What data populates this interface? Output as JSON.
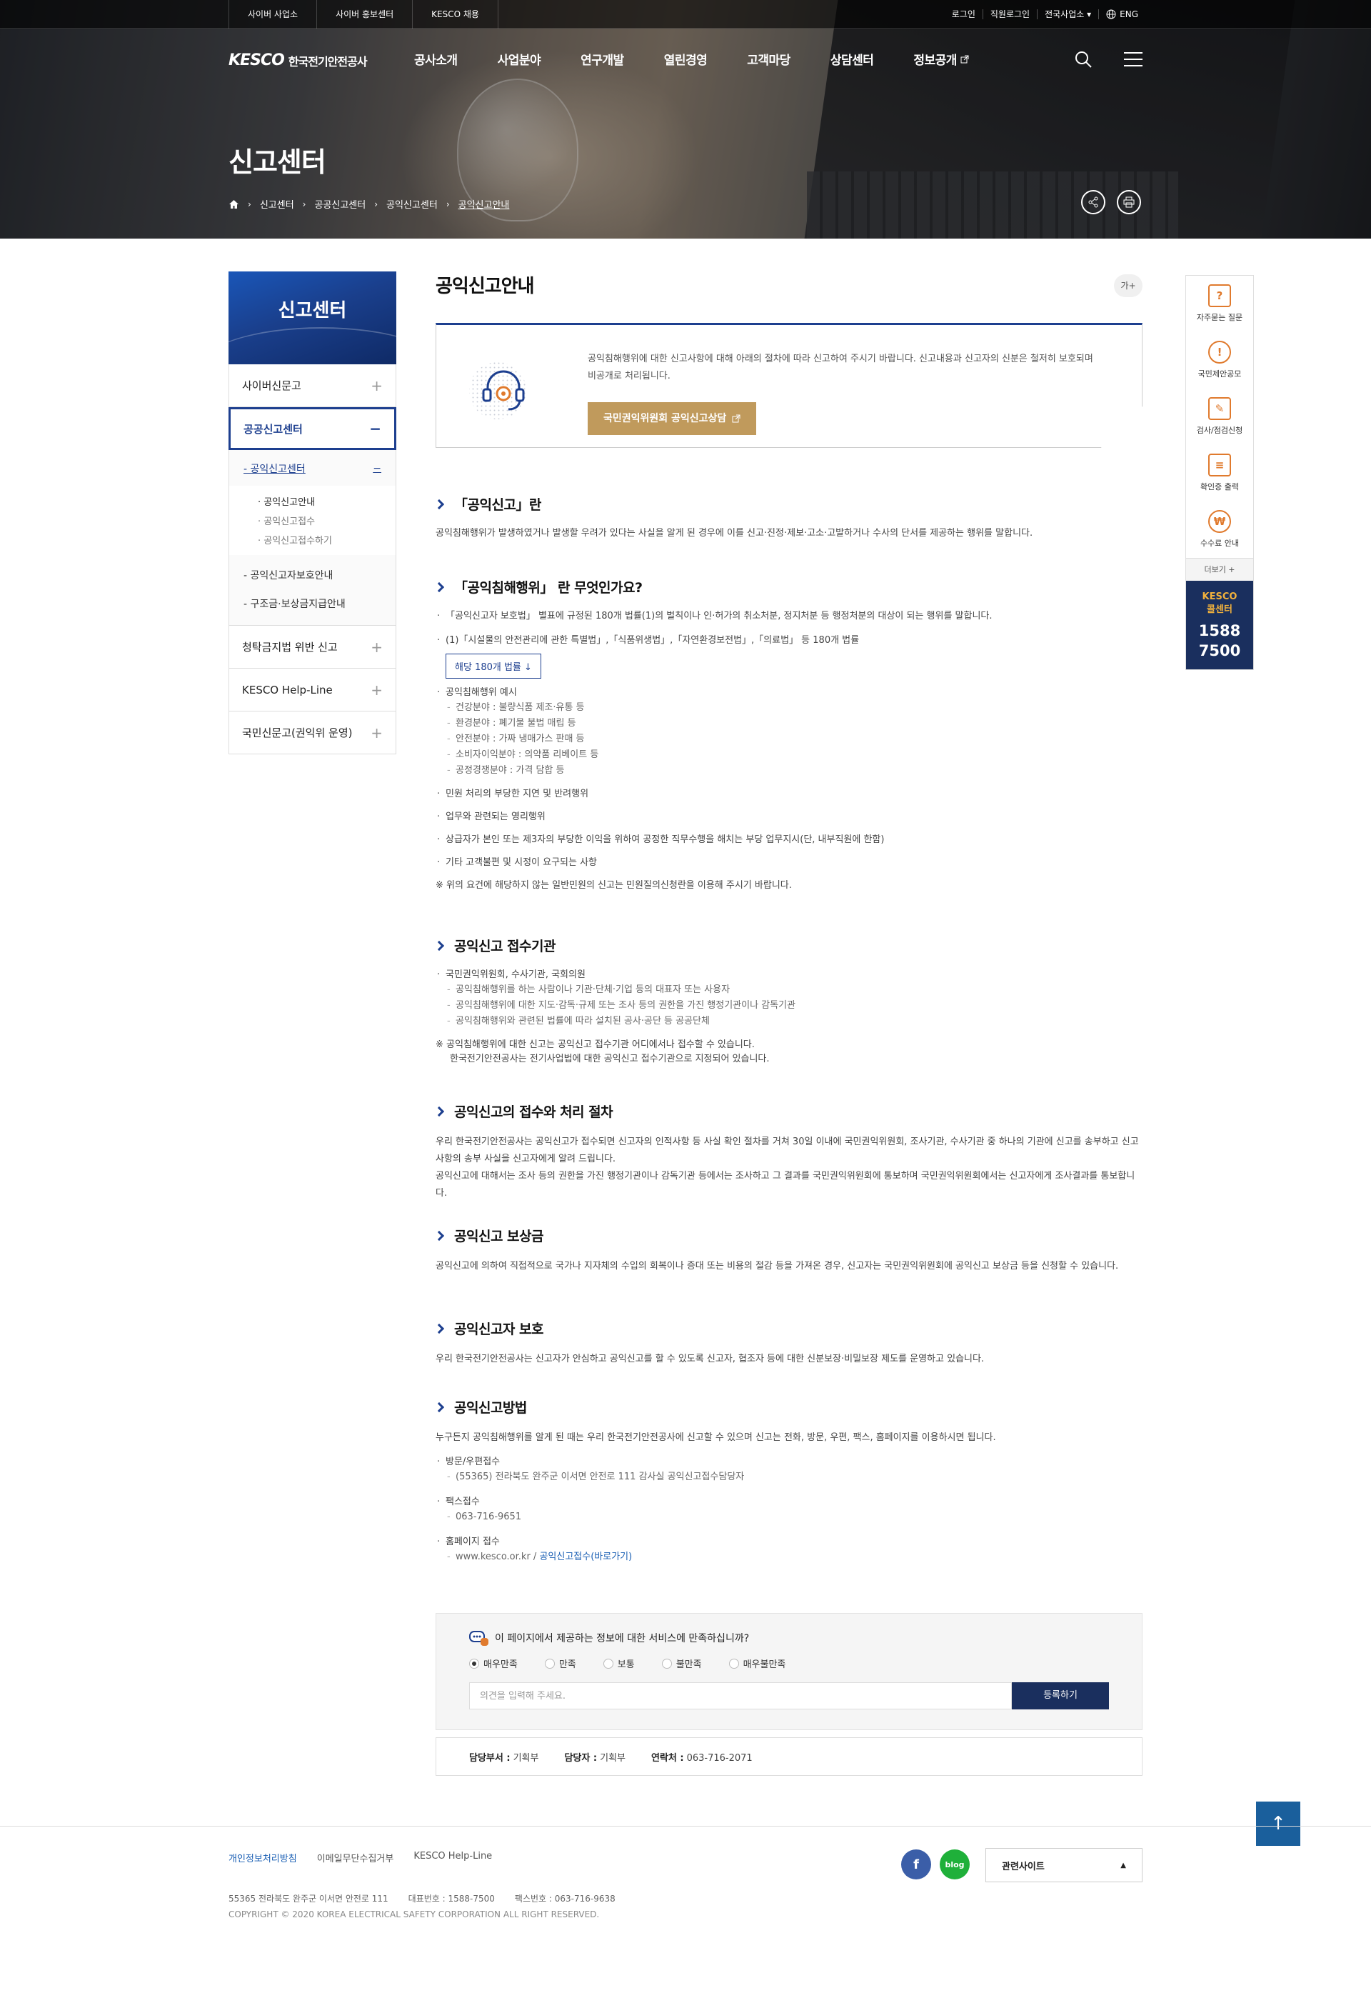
{
  "topbar": {
    "left": [
      "사이버 사업소",
      "사이버 홍보센터",
      "KESCO 채용"
    ],
    "login": "로그인",
    "staff_login": "직원로그인",
    "branch": "전국사업소",
    "lang": "ENG"
  },
  "logo": {
    "mark": "KESCO",
    "name": "한국전기안전공사"
  },
  "menu": [
    "공사소개",
    "사업분야",
    "연구개발",
    "열린경영",
    "고객마당",
    "상담센터",
    "정보공개"
  ],
  "visual_title": "신고센터",
  "breadcrumb": [
    "신고센터",
    "공공신고센터",
    "공익신고센터",
    "공익신고안내"
  ],
  "lnb": {
    "title": "신고센터",
    "items": [
      "사이버신문고",
      "공공신고센터",
      "청탁금지법 위반 신고",
      "KESCO Help-Line",
      "국민신문고(권익위 운영)"
    ],
    "sub": {
      "cur": "공익신고센터",
      "d3": [
        "공익신고안내",
        "공익신고접수",
        "공익신고접수하기"
      ],
      "others": [
        "공익신고자보호안내",
        "구조금·보상금지급안내"
      ]
    }
  },
  "content": {
    "title": "공익신고안내",
    "font_btn": "가+",
    "intro_text": "공익침해행위에 대한 신고사항에 대해 아래의 절차에 따라 신고하여 주시기 바랍니다. 신고내용과 신고자의 신분은 철저히 보호되며 비공개로 처리됩니다.",
    "intro_btn": "국민권익위원회 공익신고상담",
    "s1": {
      "title": "「공익신고」란",
      "text": "공익침해행위가 발생하였거나 발생할 우려가 있다는 사실을 알게 된 경우에 이를 신고·진정·제보·고소·고발하거나 수사의 단서를 제공하는 행위를 말합니다."
    },
    "s2": {
      "title": "「공익침해행위」 란 무엇인가요?",
      "b1": "「공익신고자 보호법」 별표에 규정된 180개 법률(1)의 벌칙이나 인·허가의 취소처분, 정지처분 등 행정처분의 대상이 되는 행위를 말합니다.",
      "b2": "(1)「시설물의 안전관리에 관한 특별법」,「식품위생법」,「자연환경보전법」,「의료법」 등 180개 법률",
      "law_btn": "해당 180개 법률",
      "ex_title": "공익침해행위 예시",
      "ex": [
        "건강분야 : 불량식품 제조·유통 등",
        "환경분야 : 폐기물 불법 매립 등",
        "안전분야 : 가짜 냉매가스 판매 등",
        "소비자이익분야 : 의약품 리베이트 등",
        "공정경쟁분야 : 가격 담합 등"
      ],
      "b3": "민원 처리의 부당한 지연 및 반려행위",
      "b4": "업무와 관련되는 영리행위",
      "b5": "상급자가 본인 또는 제3자의 부당한 이익을 위하여 공정한 직무수행을 해치는 부당 업무지시(단, 내부직원에 한함)",
      "b6": "기타 고객불편 및 시정이 요구되는 사항",
      "note": "※ 위의 요건에 해당하지 않는 일반민원의 신고는 민원질의신청란을 이용해 주시기 바랍니다."
    },
    "s3": {
      "title": "공익신고 접수기관",
      "b1": "국민권익위원회, 수사기관, 국회의원",
      "d": [
        "공익침해행위를 하는 사람이나 기관·단체·기업 등의 대표자 또는 사용자",
        "공익침해행위에 대한 지도·감독·규제 또는 조사 등의 권한을 가진 행정기관이나 감독기관",
        "공익침해행위와 관련된 법률에 따라 설치된 공사·공단 등 공공단체"
      ],
      "note1": "※ 공익침해행위에 대한 신고는 공익신고 접수기관 어디에서나 접수할 수 있습니다.",
      "note2": "한국전기안전공사는 전기사업법에 대한 공익신고 접수기관으로 지정되어 있습니다."
    },
    "s4": {
      "title": "공익신고의 접수와 처리 절차",
      "t1": "우리 한국전기안전공사는 공익신고가 접수되면 신고자의 인적사항 등 사실 확인 절차를 거쳐 30일 이내에 국민권익위원회, 조사기관, 수사기관 중 하나의 기관에 신고를 송부하고 신고 사항의 송부 사실을 신고자에게 알려 드립니다.",
      "t2": "공익신고에 대해서는 조사 등의 권한을 가진 행정기관이나 감독기관 등에서는 조사하고 그 결과를 국민권익위원회에 통보하며 국민권익위원회에서는 신고자에게 조사결과를 통보합니다."
    },
    "s5": {
      "title": "공익신고 보상금",
      "text": "공익신고에 의하여 직접적으로 국가나 지자체의 수입의 회복이나 증대 또는 비용의 절감 등을 가져온 경우, 신고자는 국민권익위원회에 공익신고 보상금 등을 신청할 수 있습니다."
    },
    "s6": {
      "title": "공익신고자 보호",
      "text": "우리 한국전기안전공사는 신고자가 안심하고 공익신고를 할 수 있도록 신고자, 협조자 등에 대한 신분보장·비밀보장 제도를 운영하고 있습니다."
    },
    "s7": {
      "title": "공익신고방법",
      "text": "누구든지 공익침해행위를 알게 된 때는 우리 한국전기안전공사에 신고할 수 있으며 신고는 전화, 방문, 우편, 팩스, 홈페이지를 이용하시면 됩니다.",
      "m1": "방문/우편접수",
      "m1d": "(55365) 전라북도 완주군 이서면 안전로 111 감사실 공익신고접수담당자",
      "m2": "팩스접수",
      "m2d": "063-716-9651",
      "m3": "홈페이지 접수",
      "m3d": "www.kesco.or.kr / ",
      "m3link": "공익신고접수(바로가기)"
    }
  },
  "survey": {
    "question": "이 페이지에서 제공하는 정보에 대한 서비스에 만족하십니까?",
    "options": [
      "매우만족",
      "만족",
      "보통",
      "불만족",
      "매우불만족"
    ],
    "selected": 0,
    "placeholder": "의견을 입력해 주세요.",
    "submit": "등록하기"
  },
  "manager": {
    "dept_label": "담당부서 :",
    "dept": "기획부",
    "person_label": "담당자 :",
    "person": "기획부",
    "tel_label": "연락처 :",
    "tel": "063-716-2071"
  },
  "quick": {
    "items": [
      "자주묻는 질문",
      "국민제안공모",
      "검사/점검신청",
      "확인증 출력",
      "수수료 안내"
    ],
    "more": "더보기 +",
    "call_label1": "KESCO",
    "call_label2": "콜센터",
    "call1": "1588",
    "call2": "7500"
  },
  "footer": {
    "links": [
      "개인정보처리방침",
      "이메일무단수집거부",
      "KESCO Help-Line"
    ],
    "address": "55365 전라북도 완주군 이서면 안전로 111",
    "tel": "대표번호 : 1588-7500",
    "fax": "팩스번호 : 063-716-9638",
    "copy": "COPYRIGHT © 2020 KOREA ELECTRICAL SAFETY CORPORATION ALL RIGHT RESERVED.",
    "related": "관련사이트",
    "blog": "blog"
  },
  "colors": {
    "navy": "#1d3f8f",
    "gold": "#c09a5c",
    "dark_navy": "#1a2f5e",
    "accent_orange": "#e07a2d"
  }
}
